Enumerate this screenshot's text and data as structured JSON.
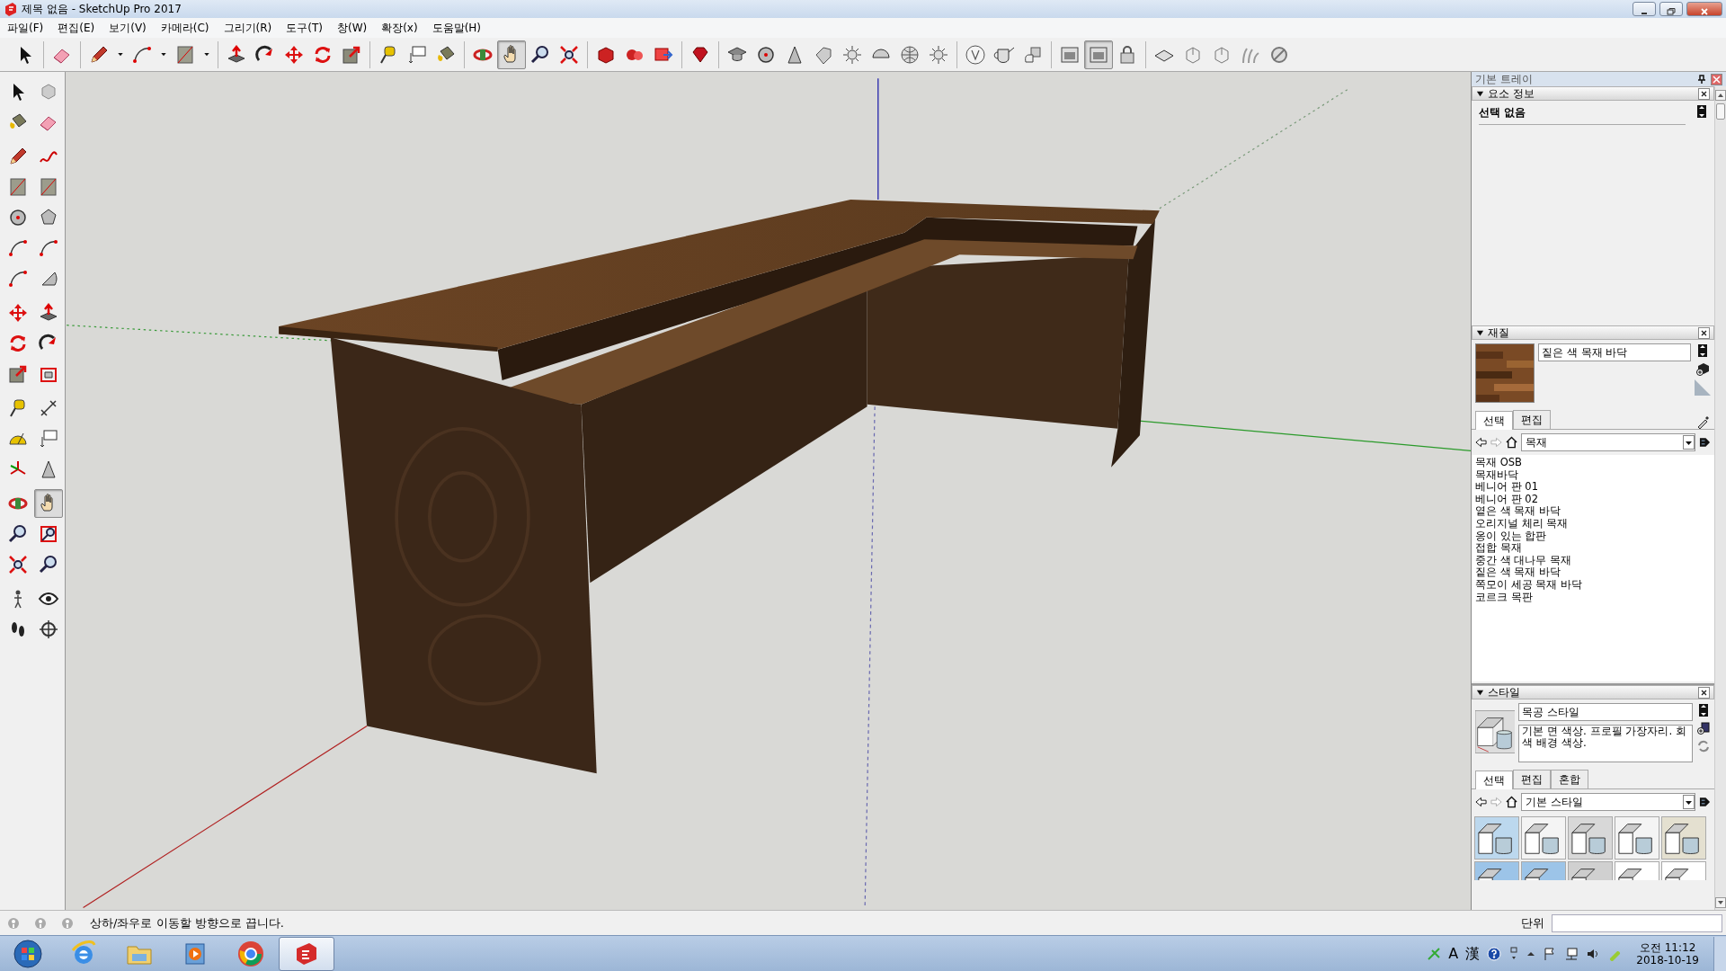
{
  "window": {
    "title": "제목 없음 - SketchUp Pro 2017"
  },
  "menu": [
    "파일(F)",
    "편집(E)",
    "보기(V)",
    "카메라(C)",
    "그리기(R)",
    "도구(T)",
    "창(W)",
    "확장(x)",
    "도움말(H)"
  ],
  "toolbar": [
    {
      "kind": "select",
      "selected": false
    },
    {
      "kind": "separator"
    },
    {
      "kind": "eraser",
      "selected": false
    },
    {
      "kind": "separator"
    },
    {
      "kind": "pencil",
      "selected": false
    },
    {
      "kind": "caret",
      "selected": false
    },
    {
      "kind": "arc",
      "selected": false
    },
    {
      "kind": "caret",
      "selected": false
    },
    {
      "kind": "rectangle",
      "selected": false
    },
    {
      "kind": "caret",
      "selected": false
    },
    {
      "kind": "separator"
    },
    {
      "kind": "push-pull",
      "selected": false
    },
    {
      "kind": "follow-me",
      "selected": false
    },
    {
      "kind": "move",
      "selected": false
    },
    {
      "kind": "rotate",
      "selected": false
    },
    {
      "kind": "scale",
      "selected": false
    },
    {
      "kind": "separator"
    },
    {
      "kind": "tape-measure",
      "selected": false
    },
    {
      "kind": "text",
      "selected": false
    },
    {
      "kind": "paint-bucket",
      "selected": false
    },
    {
      "kind": "separator"
    },
    {
      "kind": "orbit",
      "selected": false
    },
    {
      "kind": "hand",
      "selected": true
    },
    {
      "kind": "zoom",
      "selected": false
    },
    {
      "kind": "zoom-extents",
      "selected": false
    },
    {
      "kind": "separator"
    },
    {
      "kind": "warehouse",
      "selected": false
    },
    {
      "kind": "components",
      "selected": false
    },
    {
      "kind": "share",
      "selected": false
    },
    {
      "kind": "separator"
    },
    {
      "kind": "gem",
      "selected": false
    },
    {
      "kind": "separator"
    },
    {
      "kind": "cap",
      "selected": false
    },
    {
      "kind": "circle",
      "selected": false
    },
    {
      "kind": "cone",
      "selected": false
    },
    {
      "kind": "tag",
      "selected": false
    },
    {
      "kind": "sun",
      "selected": false
    },
    {
      "kind": "half-circle",
      "selected": false
    },
    {
      "kind": "globe",
      "selected": false
    },
    {
      "kind": "sun",
      "selected": false
    },
    {
      "kind": "separator"
    },
    {
      "kind": "letter-circle",
      "selected": false
    },
    {
      "kind": "teapot",
      "selected": false
    },
    {
      "kind": "hand-cube",
      "selected": false
    },
    {
      "kind": "separator"
    },
    {
      "kind": "window",
      "selected": false
    },
    {
      "kind": "window",
      "selected": true
    },
    {
      "kind": "lock",
      "selected": false
    },
    {
      "kind": "separator"
    },
    {
      "kind": "plane",
      "selected": false
    },
    {
      "kind": "cube",
      "selected": false
    },
    {
      "kind": "cube",
      "selected": false
    },
    {
      "kind": "grass",
      "selected": false
    },
    {
      "kind": "slash-circle",
      "selected": false
    }
  ],
  "tool_palette": [
    [
      {
        "kind": "select",
        "selected": false
      },
      {
        "kind": "component",
        "selected": false
      },
      {
        "kind": "paint-bucket",
        "selected": false
      },
      {
        "kind": "eraser",
        "selected": false
      }
    ],
    [
      {
        "kind": "pencil",
        "selected": false
      },
      {
        "kind": "freehand",
        "selected": false
      },
      {
        "kind": "rectangle",
        "selected": false
      },
      {
        "kind": "rectangle",
        "selected": false
      },
      {
        "kind": "circle",
        "selected": false
      },
      {
        "kind": "polygon",
        "selected": false
      },
      {
        "kind": "arc",
        "selected": false
      },
      {
        "kind": "arc",
        "selected": false
      },
      {
        "kind": "arc",
        "selected": false
      },
      {
        "kind": "pie",
        "selected": false
      }
    ],
    [
      {
        "kind": "move",
        "selected": false
      },
      {
        "kind": "push-pull",
        "selected": false
      },
      {
        "kind": "rotate",
        "selected": false
      },
      {
        "kind": "follow-me",
        "selected": false
      },
      {
        "kind": "scale",
        "selected": false
      },
      {
        "kind": "offset",
        "selected": false
      }
    ],
    [
      {
        "kind": "tape-measure",
        "selected": false
      },
      {
        "kind": "dimension",
        "selected": false
      },
      {
        "kind": "protractor",
        "selected": false
      },
      {
        "kind": "text",
        "selected": false
      },
      {
        "kind": "axes",
        "selected": false
      },
      {
        "kind": "cone",
        "selected": false
      }
    ],
    [
      {
        "kind": "orbit",
        "selected": false
      },
      {
        "kind": "hand",
        "selected": true
      },
      {
        "kind": "zoom",
        "selected": false
      },
      {
        "kind": "zoom-window",
        "selected": false
      },
      {
        "kind": "zoom-extents",
        "selected": false
      },
      {
        "kind": "zoom",
        "selected": false
      }
    ],
    [
      {
        "kind": "person",
        "selected": false
      },
      {
        "kind": "eye",
        "selected": false
      },
      {
        "kind": "footprints",
        "selected": false
      },
      {
        "kind": "crosshair",
        "selected": false
      }
    ]
  ],
  "tray": {
    "title": "기본 트레이",
    "entity_info": {
      "title": "요소 정보",
      "expanded": true,
      "selection": "선택 없음"
    },
    "materials": {
      "title": "재질",
      "expanded": true,
      "name": "짙은 색 목재 바닥",
      "tabs": [
        {
          "label": "선택",
          "selected": true
        },
        {
          "label": "편집",
          "selected": false
        }
      ],
      "collection": "목재",
      "items": [
        "목재 OSB",
        "목재바닥",
        "베니어 판 01",
        "베니어 판 02",
        "옅은 색 목재 바닥",
        "오리지널 체리 목재",
        "옹이 있는 합판",
        "접합 목재",
        "중간 색 대나무 목재",
        "짙은 색 목재 바닥",
        "쪽모이 세공 목재 바닥",
        "코르크 목판"
      ]
    },
    "styles": {
      "title": "스타일",
      "expanded": true,
      "name": "목공 스타일",
      "description": "기본 면 색상. 프로필 가장자리. 회색 배경 색상.",
      "tabs": [
        {
          "label": "선택",
          "selected": true
        },
        {
          "label": "편집",
          "selected": false
        },
        {
          "label": "혼합",
          "selected": false
        }
      ],
      "collection": "기본 스타일"
    }
  },
  "status_bar": {
    "message": "상하/좌우로 이동할 방향으로 끕니다.",
    "measurements_label": "단위"
  },
  "taskbar": {
    "apps": [
      {
        "kind": "browser",
        "selected": false
      },
      {
        "kind": "folder",
        "selected": false
      },
      {
        "kind": "media-player",
        "selected": false
      },
      {
        "kind": "round-browser",
        "selected": false
      },
      {
        "kind": "app-logo",
        "selected": true
      }
    ],
    "ime": "A",
    "hanja": "漢",
    "time": "오전 11:12",
    "date": "2018-10-19"
  }
}
